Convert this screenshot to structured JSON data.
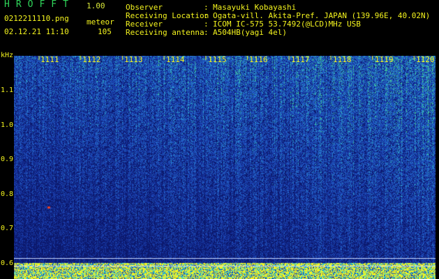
{
  "header": {
    "app_title": "HROFFT",
    "app_version": "1.00",
    "filename": "0212211110.png",
    "mode": "meteor",
    "datetime": "02.12.21 11:10",
    "count": "105"
  },
  "info": [
    {
      "label": "Observer",
      "value": "Masayuki Kobayashi"
    },
    {
      "label": "Receiving Location",
      "value": "Ogata-vill. Akita-Pref. JAPAN (139.96E, 40.02N)"
    },
    {
      "label": "Receiver",
      "value": "ICOM IC-575 53.7492(@LCD)MHz USB"
    },
    {
      "label": "Receiving antenna",
      "value": "A504HB(yagi 4el)"
    }
  ],
  "spectrogram": {
    "y_unit": "kHz",
    "y_ticks": [
      "1.1",
      "1.0",
      "0.9",
      "0.8",
      "0.7",
      "0.6"
    ],
    "x_ticks": [
      "1111",
      "1112",
      "1113",
      "1114",
      "1115",
      "1116",
      "1117",
      "1118",
      "1119",
      "1120"
    ],
    "colors": {
      "background": "#0a1470",
      "noise_low": "#1b3fae",
      "noise_mid": "#2b7fd0",
      "noise_high": "#3fc8a0",
      "signal": "#f5f51e",
      "meteor": "#e0402a"
    }
  }
}
